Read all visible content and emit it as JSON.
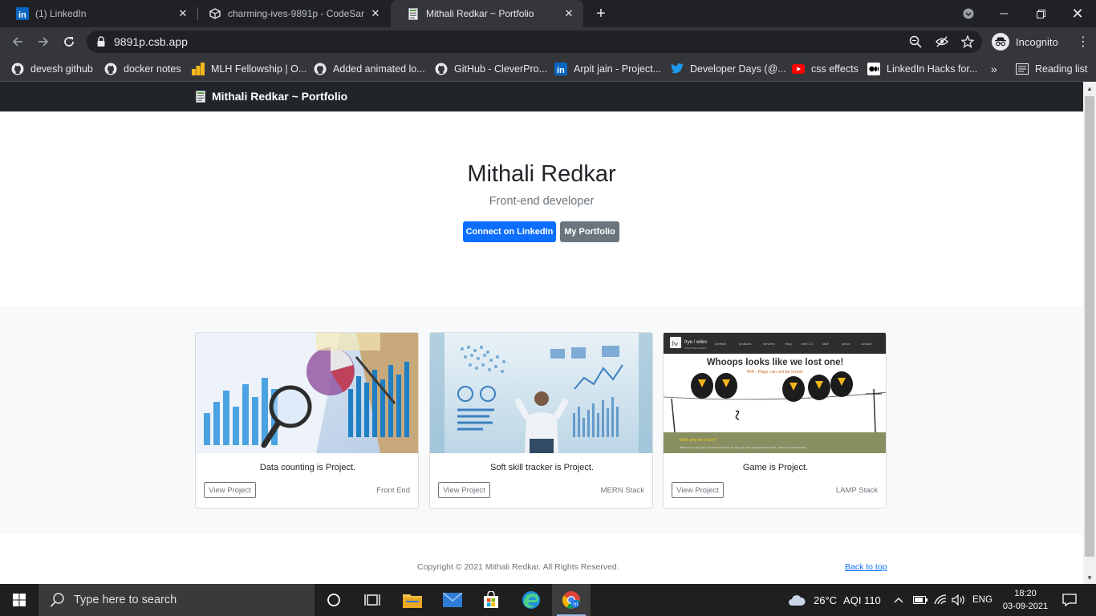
{
  "browser": {
    "tabs": [
      {
        "label": "(1) LinkedIn",
        "icon": "linkedin-icon",
        "active": false
      },
      {
        "label": "charming-ives-9891p - CodeSandbox",
        "icon": "codesandbox-icon",
        "active": false
      },
      {
        "label": "Mithali Redkar ~ Portfolio",
        "icon": "document-icon",
        "active": true
      }
    ],
    "url": "9891p.csb.app",
    "profile_label": "Incognito",
    "bookmarks": [
      {
        "label": "devesh github",
        "icon": "github-icon"
      },
      {
        "label": "docker notes",
        "icon": "github-icon"
      },
      {
        "label": "MLH Fellowship | O...",
        "icon": "mlh-icon"
      },
      {
        "label": "Added animated lo...",
        "icon": "github-icon"
      },
      {
        "label": "GitHub - CleverPro...",
        "icon": "github-icon"
      },
      {
        "label": "Arpit jain - Project...",
        "icon": "linkedin-icon"
      },
      {
        "label": "Developer Days (@...",
        "icon": "twitter-icon"
      },
      {
        "label": "css effects",
        "icon": "youtube-icon"
      },
      {
        "label": "LinkedIn Hacks for...",
        "icon": "medium-icon"
      }
    ],
    "bookmarks_overflow": "»",
    "reading_list": "Reading list"
  },
  "site": {
    "brand": "Mithali Redkar ~ Portfolio",
    "hero": {
      "name": "Mithali Redkar",
      "tagline": "Front-end developer",
      "primary_button": "Connect on LinkedIn",
      "secondary_button": "My Portfolio"
    },
    "projects": [
      {
        "title": "Data counting is Project.",
        "button": "View Project",
        "tag": "Front End"
      },
      {
        "title": "Soft skill tracker is Project.",
        "button": "View Project",
        "tag": "MERN Stack"
      },
      {
        "title": "Game is Project.",
        "button": "View Project",
        "tag": "LAMP Stack"
      }
    ],
    "game_preview": {
      "logo": "fw",
      "brand": "frye / wiles",
      "brand_sub": "CREATIVE AGENCY",
      "nav": [
        "portfolio",
        "products",
        "services",
        "blog",
        "web 2.0",
        "staff",
        "about",
        "contact"
      ],
      "headline": "Whoops looks like we lost one!",
      "subline": "404 - Page can not be found.",
      "band_title": "Well, why am i here?",
      "band_text": "Welcome to a new page. You are here because the page you have requested doesn't exist... at least not at this location."
    },
    "footer": {
      "copyright": "Copyright © 2021 Mithali Redkar. All Rights Reserved.",
      "back_to_top": "Back to top"
    }
  },
  "taskbar": {
    "search_placeholder": "Type here to search",
    "weather": "26°C",
    "aqi": "AQI 110",
    "language": "ENG",
    "time": "18:20",
    "date": "03-09-2021"
  }
}
